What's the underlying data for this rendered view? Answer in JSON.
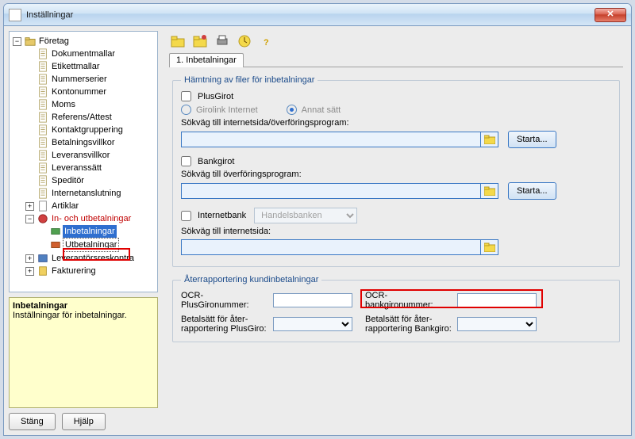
{
  "window_title": "Inställningar",
  "tree": {
    "root": "Företag",
    "root_items": [
      "Dokumentmallar",
      "Etikettmallar",
      "Nummerserier",
      "Kontonummer",
      "Moms",
      "Referens/Attest",
      "Kontaktgruppering",
      "Betalningsvillkor",
      "Leveransvillkor",
      "Leveranssätt",
      "Speditör",
      "Internetanslutning"
    ],
    "artiklar": "Artiklar",
    "payments": "In- och utbetalningar",
    "inbetalningar": "Inbetalningar",
    "utbetalningar": "Utbetalningar",
    "leverantor": "Leverantörsreskontra",
    "fakturering": "Fakturering"
  },
  "info": {
    "title": "Inbetalningar",
    "text": "Inställningar för inbetalningar."
  },
  "buttons": {
    "close": "Stäng",
    "help": "Hjälp"
  },
  "tab_label": "1. Inbetalningar",
  "group1": {
    "legend": "Hämtning av filer för inbetalningar",
    "plusgirot": "PlusGirot",
    "girolink": "Girolink Internet",
    "annat": "Annat sätt",
    "sokvag1": "Sökväg till internetsida/överföringsprogram:",
    "starta": "Starta...",
    "bankgirot": "Bankgirot",
    "sokvag2": "Sökväg till överföringsprogram:",
    "internetbank": "Internetbank",
    "bank_value": "Handelsbanken",
    "sokvag3": "Sökväg till internetsida:"
  },
  "group2": {
    "legend": "Återrapportering kundinbetalningar",
    "ocr_pg": "OCR-PlusGironummer:",
    "ocr_bg": "OCR-bankgironummer:",
    "betal_pg": "Betalsätt för åter-\nrapportering PlusGiro:",
    "betal_bg": "Betalsätt för åter-\nrapportering Bankgiro:"
  }
}
